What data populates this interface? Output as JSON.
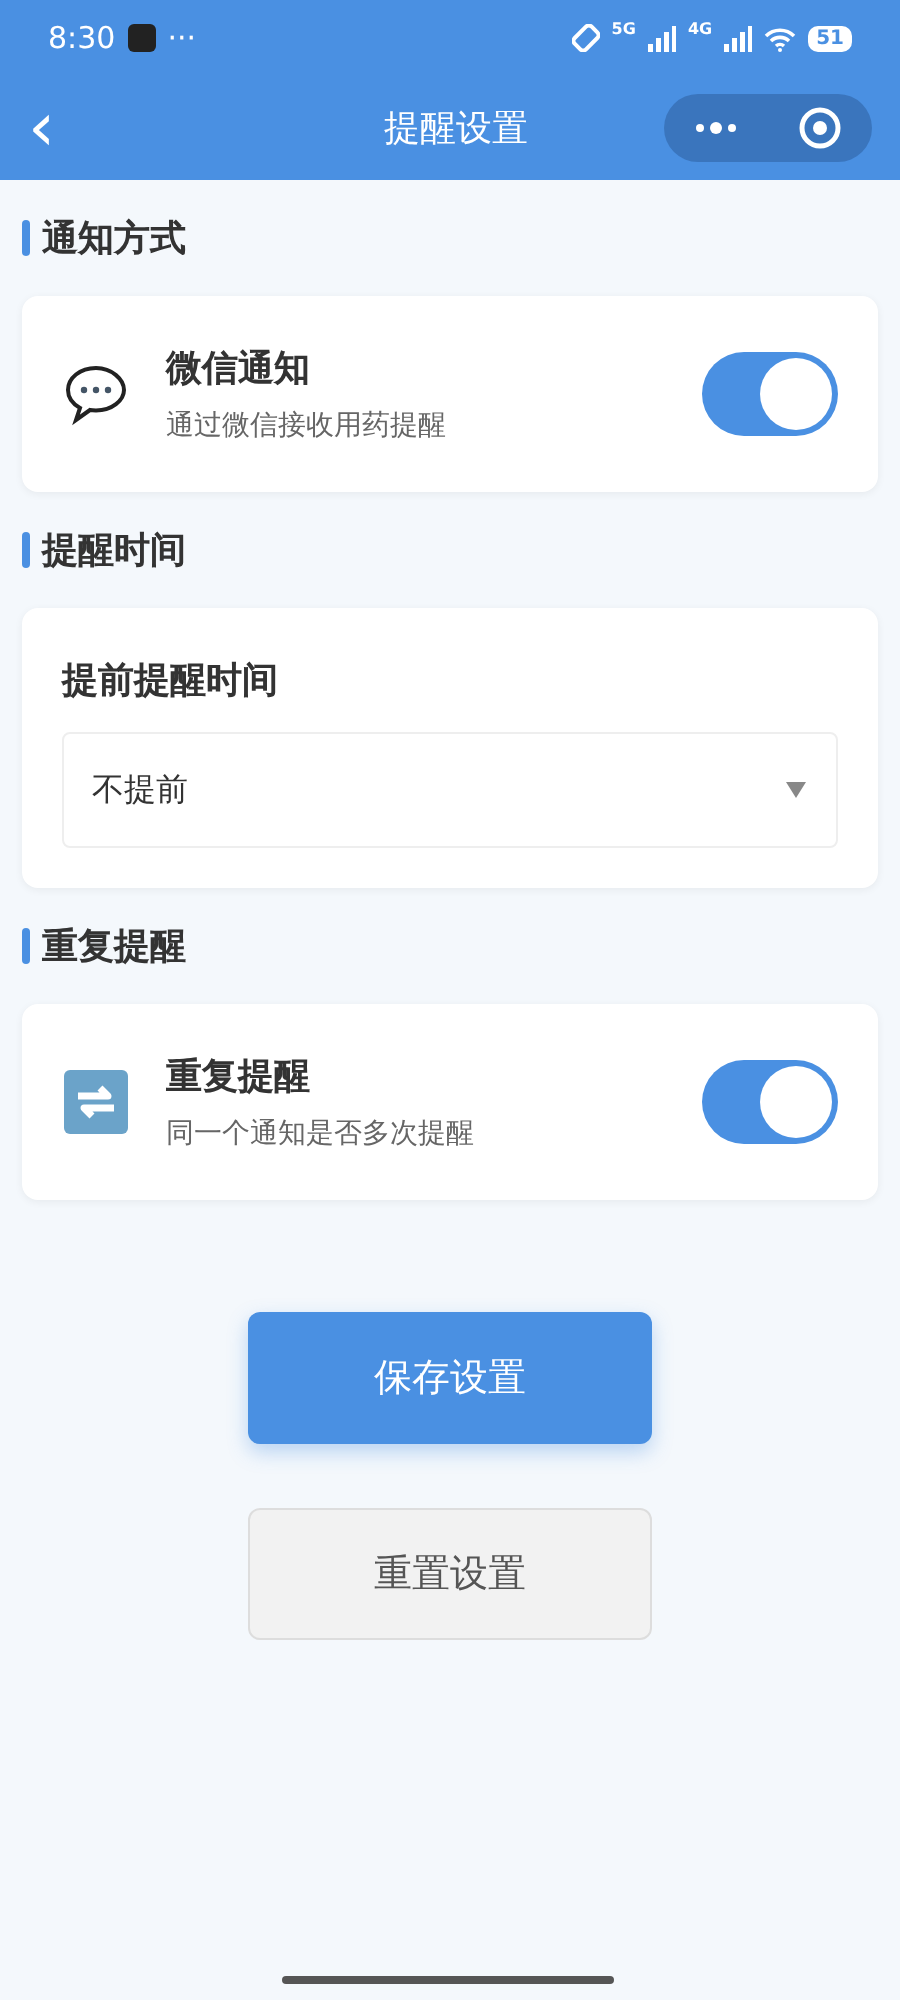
{
  "status_bar": {
    "time": "8:30",
    "more": "···",
    "net1": "5G",
    "net2": "4G",
    "battery": "51"
  },
  "nav": {
    "back": "‹",
    "title": "提醒设置"
  },
  "sections": [
    {
      "title": "通知方式",
      "kind": "toggle",
      "label": "微信通知",
      "description": "通过微信接收用药提醒",
      "on": true
    },
    {
      "title": "提醒时间",
      "kind": "select",
      "label": "提前提醒时间",
      "value": "不提前"
    },
    {
      "title": "重复提醒",
      "kind": "toggle",
      "label": "重复提醒",
      "description": "同一个通知是否多次提醒",
      "on": true
    }
  ],
  "buttons": [
    {
      "label": "保存设置",
      "kind": "primary"
    },
    {
      "label": "重置设置",
      "kind": "secondary"
    }
  ]
}
